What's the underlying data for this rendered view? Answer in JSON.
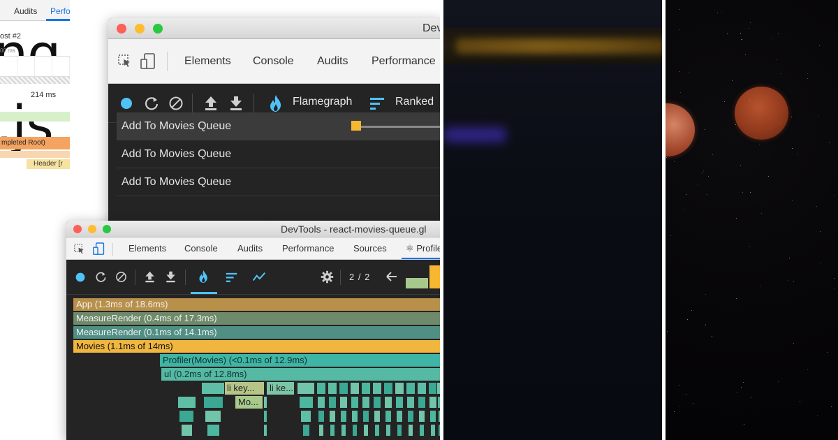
{
  "title": {
    "line1": "ng",
    "line2": ".js"
  },
  "back_window": {
    "title": "Dev",
    "tabs": [
      "Elements",
      "Console",
      "Audits",
      "Performance"
    ],
    "toolbar": {
      "flamegraph_label": "Flamegraph",
      "ranked_label": "Ranked"
    },
    "commits": [
      "Add To Movies Queue",
      "Add To Movies Queue",
      "Add To Movies Queue"
    ],
    "slider_value": 0.0
  },
  "front_window": {
    "title": "DevTools - react-movies-queue.gl",
    "tabs": [
      "Elements",
      "Console",
      "Audits",
      "Performance",
      "Sources",
      "⚛ Profile"
    ],
    "commit_counter": "2 / 2",
    "flame_rows": [
      {
        "label": "App (1.3ms of 18.6ms)",
        "color": "#b8904a"
      },
      {
        "label": "MeasureRender (0.4ms of 17.3ms)",
        "color": "#6f8a6a"
      },
      {
        "label": "MeasureRender (0.1ms of 14.1ms)",
        "color": "#4f8f84"
      },
      {
        "label": "Movies (1.1ms of 14ms)",
        "color": "#f0b63f"
      },
      {
        "label": "Profiler(Movies) (<0.1ms of 12.9ms)",
        "color": "#3fb5a6"
      },
      {
        "label": "ul (0.2ms of 12.8ms)",
        "color": "#55b9a3"
      },
      {
        "label": "li key...",
        "color": "#b5c588"
      },
      {
        "label": "li ke...",
        "color": "#7cc5a6"
      },
      {
        "label": "Mo...",
        "color": "#a8c98c"
      }
    ]
  },
  "side_window": {
    "tabs": [
      "Audits",
      "Perfo"
    ],
    "label_post": "ost #2",
    "label_ms_small": "00 ms",
    "label_ms": "214 ms",
    "label_root": "mpleted Root)",
    "label_header": "Header [r"
  },
  "colors": {
    "accent_blue": "#4fc3f7",
    "selected_handle": "#f7b731",
    "toolbar_bg": "#242424"
  }
}
